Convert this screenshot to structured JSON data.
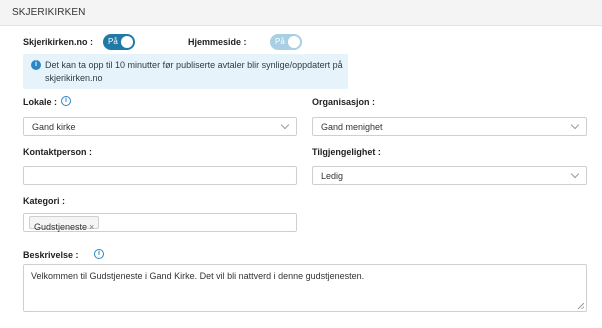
{
  "header": {
    "title": "SKJERIKIRKEN"
  },
  "toggles": {
    "skjerikirken": {
      "label": "Skjerikirken.no :",
      "state": "På"
    },
    "hjemmeside": {
      "label": "Hjemmeside :",
      "state": "På"
    }
  },
  "info": {
    "icon": "info-icon",
    "text": "Det kan ta opp til 10 minutter før publiserte avtaler blir synlige/oppdatert på skjerikirken.no"
  },
  "lokale": {
    "label": "Lokale :",
    "value": "Gand kirke",
    "icon": "info-icon"
  },
  "organisasjon": {
    "label": "Organisasjon :",
    "value": "Gand menighet"
  },
  "kontaktperson": {
    "label": "Kontaktperson :",
    "value": ""
  },
  "tilgjengelighet": {
    "label": "Tilgjengelighet :",
    "value": "Ledig"
  },
  "kategori": {
    "label": "Kategori :",
    "tags": [
      {
        "label": "Gudstjeneste",
        "remove": "×"
      }
    ]
  },
  "beskrivelse": {
    "label": "Beskrivelse :",
    "icon": "info-icon",
    "value": "Velkommen til Gudstjeneste i Gand Kirke. Det vil bli nattverd i denne gudstjenesten."
  },
  "colors": {
    "accent": "#1f7aa8",
    "accent_light": "#a8cfe3",
    "info_bg": "#e7f3fb",
    "info_icon": "#2a86c7"
  }
}
